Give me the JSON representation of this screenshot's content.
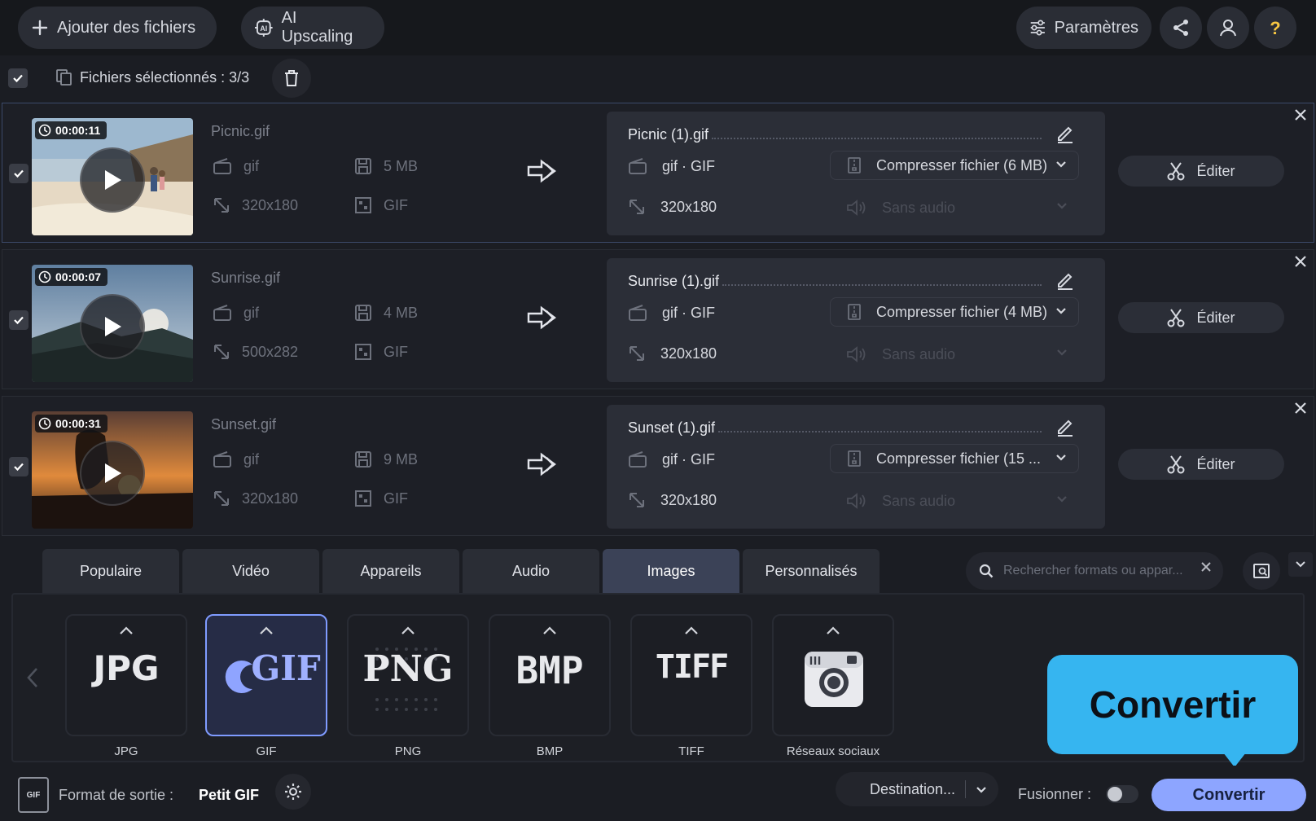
{
  "toolbar": {
    "add_files": "Ajouter des fichiers",
    "ai_upscaling": "AI Upscaling",
    "settings": "Paramètres"
  },
  "selection": {
    "label": "Fichiers sélectionnés : 3/3"
  },
  "files": [
    {
      "duration": "00:00:11",
      "name": "Picnic.gif",
      "format": "gif",
      "size": "5 MB",
      "resolution": "320x180",
      "codec": "GIF",
      "output_name": "Picnic (1).gif",
      "output_format": "gif · GIF",
      "compress": "Compresser fichier (6 MB)",
      "output_resolution": "320x180",
      "audio": "Sans audio",
      "edit": "Éditer"
    },
    {
      "duration": "00:00:07",
      "name": "Sunrise.gif",
      "format": "gif",
      "size": "4 MB",
      "resolution": "500x282",
      "codec": "GIF",
      "output_name": "Sunrise (1).gif",
      "output_format": "gif · GIF",
      "compress": "Compresser fichier (4 MB)",
      "output_resolution": "320x180",
      "audio": "Sans audio",
      "edit": "Éditer"
    },
    {
      "duration": "00:00:31",
      "name": "Sunset.gif",
      "format": "gif",
      "size": "9 MB",
      "resolution": "320x180",
      "codec": "GIF",
      "output_name": "Sunset (1).gif",
      "output_format": "gif · GIF",
      "compress": "Compresser fichier (15 ...",
      "output_resolution": "320x180",
      "audio": "Sans audio",
      "edit": "Éditer"
    }
  ],
  "format_tabs": [
    "Populaire",
    "Vidéo",
    "Appareils",
    "Audio",
    "Images",
    "Personnalisés"
  ],
  "active_tab": "Images",
  "search": {
    "placeholder": "Rechercher formats ou appar..."
  },
  "formats": [
    {
      "logo": "JPG",
      "label": "JPG",
      "selected": false
    },
    {
      "logo": "GIF",
      "label": "GIF",
      "selected": true
    },
    {
      "logo": "PNG",
      "label": "PNG",
      "selected": false
    },
    {
      "logo": "BMP",
      "label": "BMP",
      "selected": false
    },
    {
      "logo": "TIFF",
      "label": "TIFF",
      "selected": false
    },
    {
      "logo": "",
      "label": "Réseaux sociaux",
      "selected": false
    }
  ],
  "output": {
    "label": "Format de sortie :",
    "value": "Petit GIF",
    "badge": "GIF"
  },
  "destination": "Destination...",
  "merge_label": "Fusionner :",
  "convert_button": "Convertir",
  "callout": "Convertir",
  "colors": {
    "accent": "#8da5ff",
    "callout": "#36b5f0",
    "help": "#f5c542"
  }
}
